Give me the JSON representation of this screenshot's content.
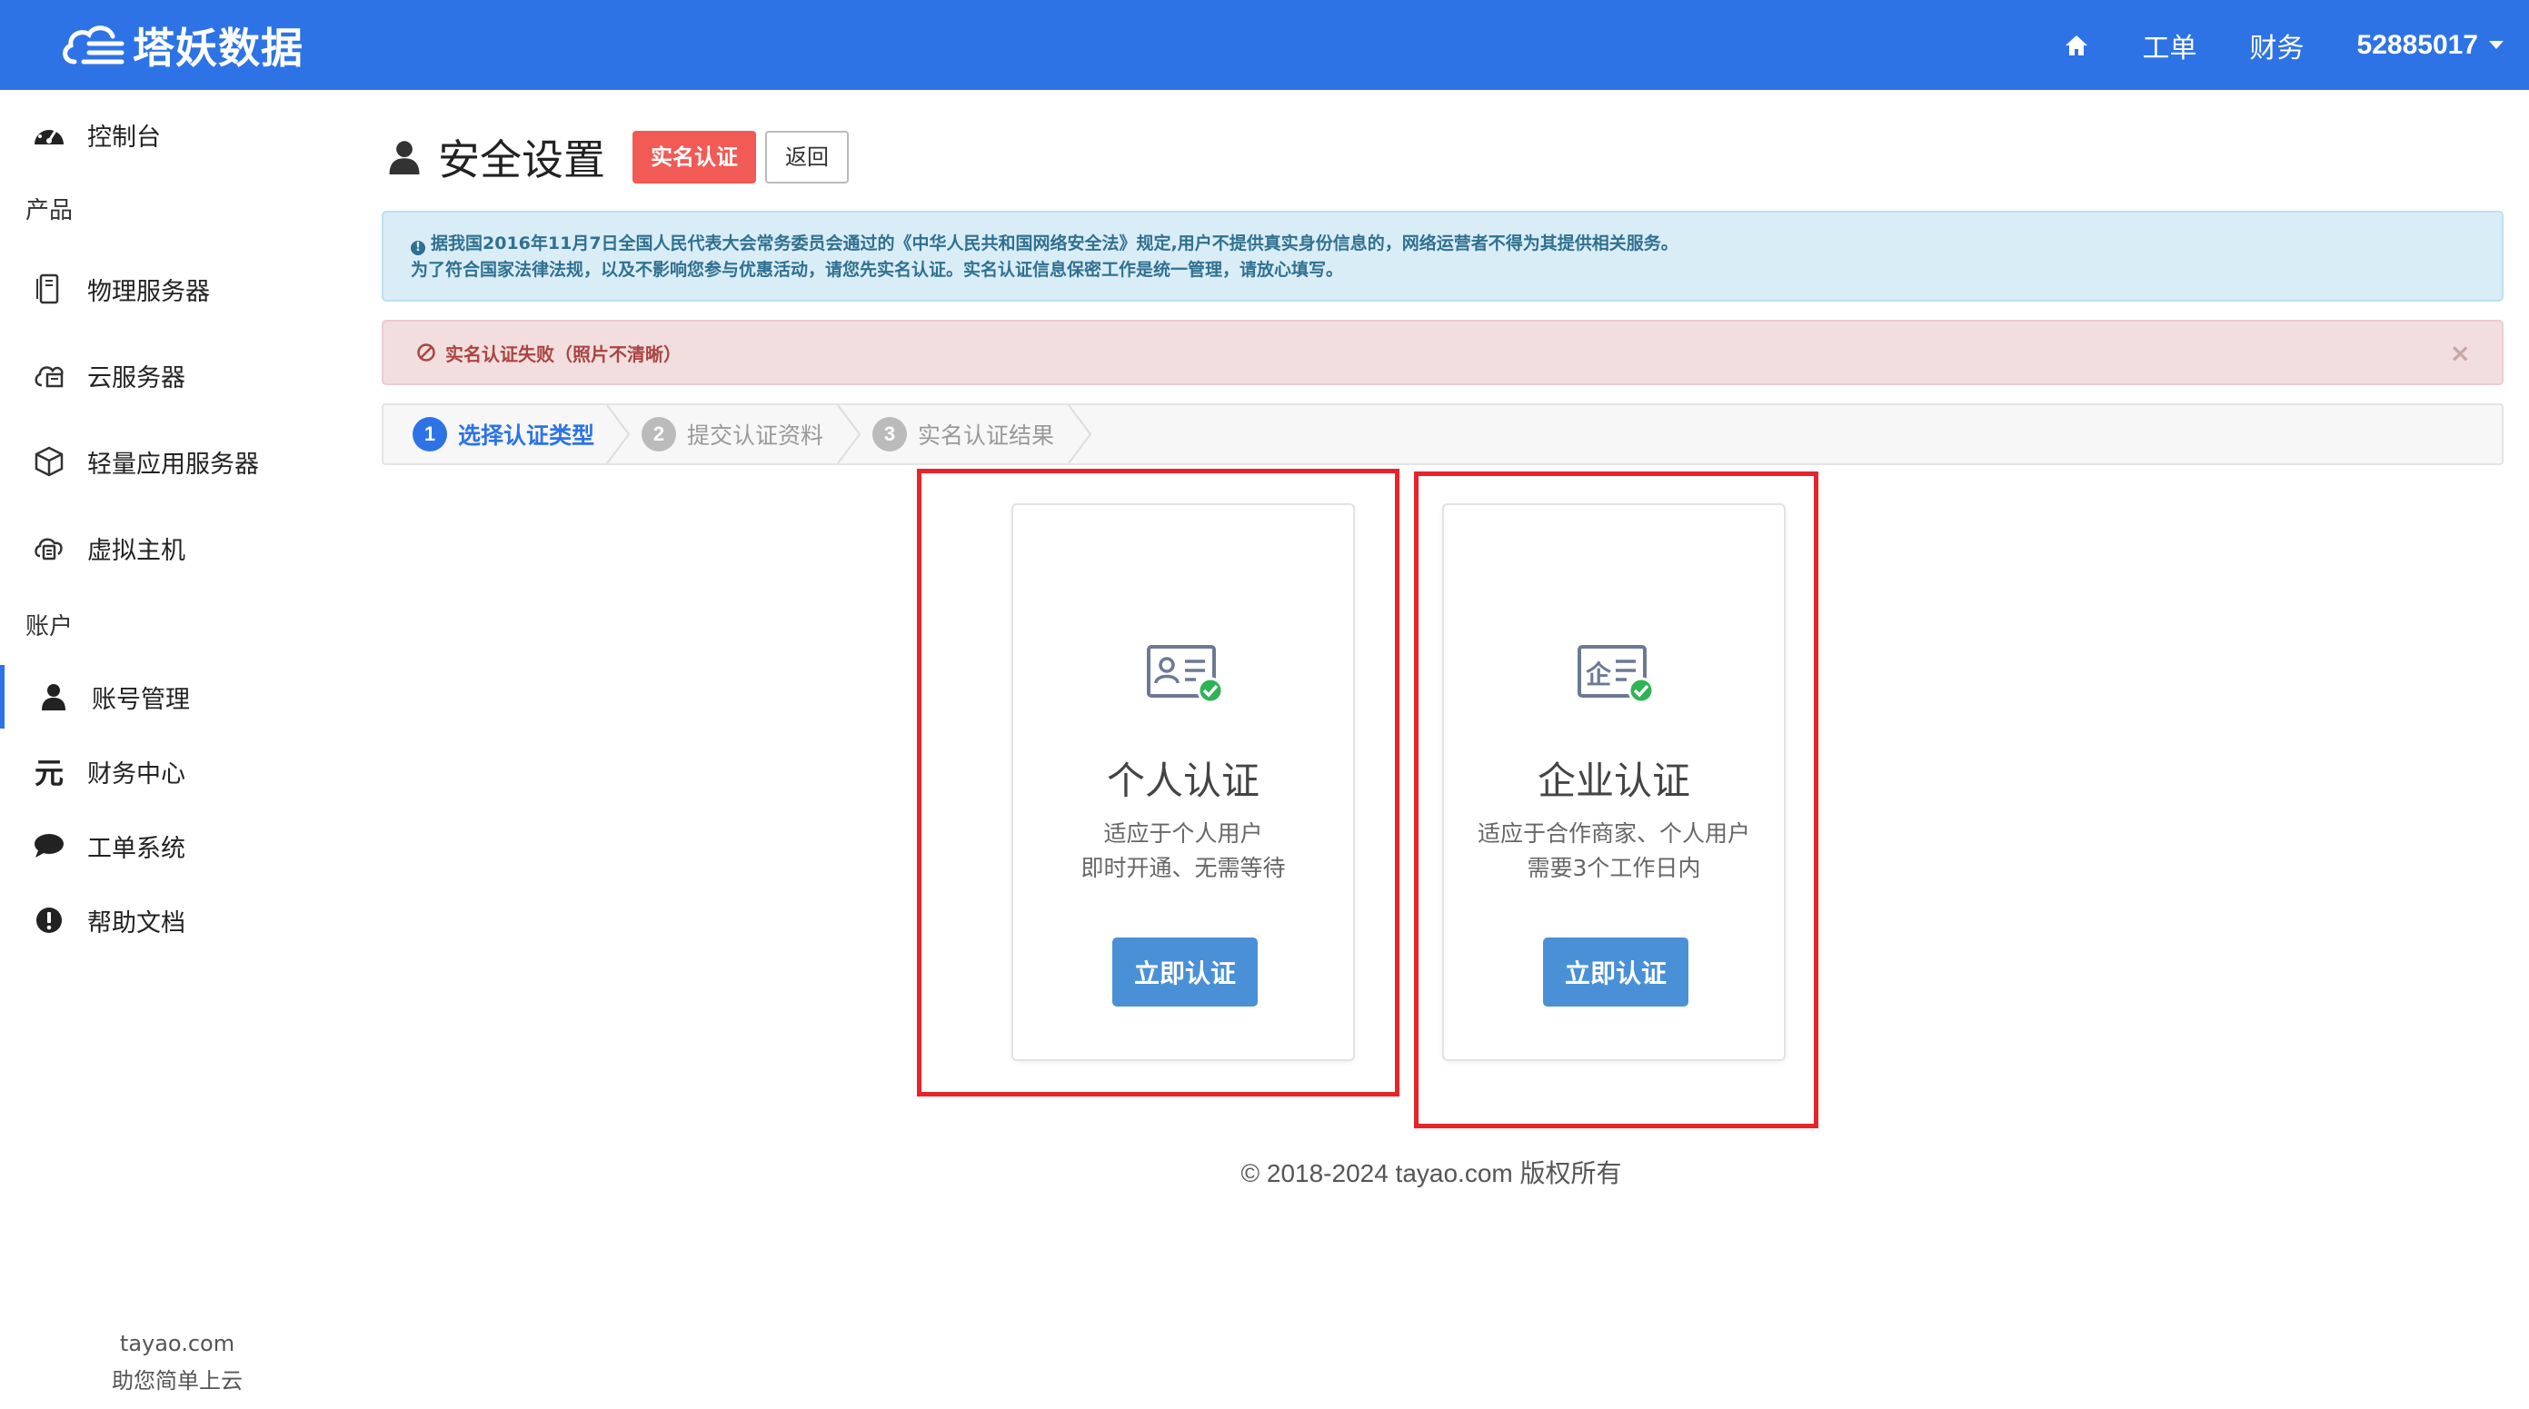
{
  "topbar": {
    "brand": "塔妖数据",
    "nav": [
      {
        "label": "工单"
      },
      {
        "label": "财务"
      }
    ],
    "user": "52885017"
  },
  "sidebar": {
    "dashboard": "控制台",
    "group_products": "产品",
    "products": [
      {
        "label": "物理服务器"
      },
      {
        "label": "云服务器"
      },
      {
        "label": "轻量应用服务器"
      },
      {
        "label": "虚拟主机"
      }
    ],
    "group_account": "账户",
    "account": [
      {
        "label": "账号管理"
      },
      {
        "label": "财务中心"
      },
      {
        "label": "工单系统"
      },
      {
        "label": "帮助文档"
      }
    ],
    "footer_domain": "tayao.com",
    "footer_slogan": "助您简单上云"
  },
  "page": {
    "title": "安全设置",
    "badge_label": "实名认证",
    "back_label": "返回"
  },
  "alerts": {
    "info_line1": "据我国2016年11月7日全国人民代表大会常务委员会通过的《中华人民共和国网络安全法》规定,用户不提供真实身份信息的，网络运营者不得为其提供相关服务。",
    "info_line2": "为了符合国家法律法规，以及不影响您参与优惠活动，请您先实名认证。实名认证信息保密工作是统一管理，请放心填写。",
    "error": "实名认证失败（照片不清晰）",
    "close": "×"
  },
  "steps": [
    {
      "num": "1",
      "label": "选择认证类型"
    },
    {
      "num": "2",
      "label": "提交认证资料"
    },
    {
      "num": "3",
      "label": "实名认证结果"
    }
  ],
  "cards": {
    "personal": {
      "title": "个人认证",
      "desc1": "适应于个人用户",
      "desc2": "即时开通、无需等待",
      "button": "立即认证"
    },
    "enterprise": {
      "title": "企业认证",
      "desc1": "适应于合作商家、个人用户",
      "desc2": "需要3个工作日内",
      "button": "立即认证",
      "icon_char": "企"
    }
  },
  "footer": "© 2018-2024 tayao.com 版权所有",
  "colors": {
    "primary": "#2d73e6",
    "danger_badge": "#f15a55",
    "button_blue": "#4a90d6",
    "highlight_box": "#e8242a"
  }
}
